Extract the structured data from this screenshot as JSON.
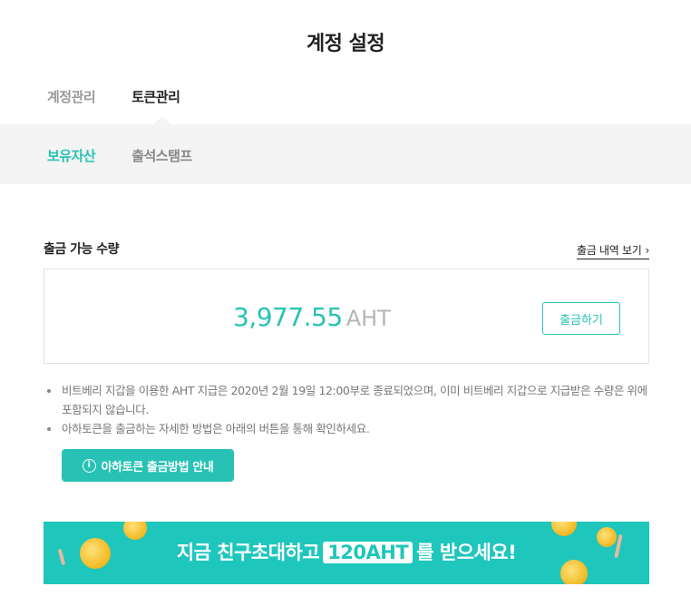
{
  "page": {
    "title": "계정 설정"
  },
  "main_tabs": [
    {
      "label": "계정관리",
      "active": false
    },
    {
      "label": "토큰관리",
      "active": true
    }
  ],
  "sub_tabs": [
    {
      "label": "보유자산",
      "active": true
    },
    {
      "label": "출석스탬프",
      "active": false
    }
  ],
  "withdrawable": {
    "label": "출금 가능 수량",
    "history_link": "출금 내역 보기",
    "amount": "3,977.55",
    "unit": "AHT",
    "withdraw_button": "출금하기"
  },
  "notes": [
    "비트베리 지갑을 이용한 AHT 지급은 2020년 2월 19일 12:00부로 종료되었으며, 이미 비트베리 지갑으로 지급받은 수량은 위에 포함되지 않습니다.",
    "아하토큰을 출금하는 자세한 방법은 아래의 버튼을 통해 확인하세요."
  ],
  "guide_button": {
    "label": "아하토큰 출금방법 안내",
    "icon": "info-circle-icon"
  },
  "banner": {
    "text_before": "지금 친구초대하고",
    "highlight": "120AHT",
    "text_after": "를 받으세요!"
  },
  "colors": {
    "accent": "#27c2b5",
    "banner_bg": "#1fc6bb",
    "subbar_bg": "#f4f4f4"
  }
}
